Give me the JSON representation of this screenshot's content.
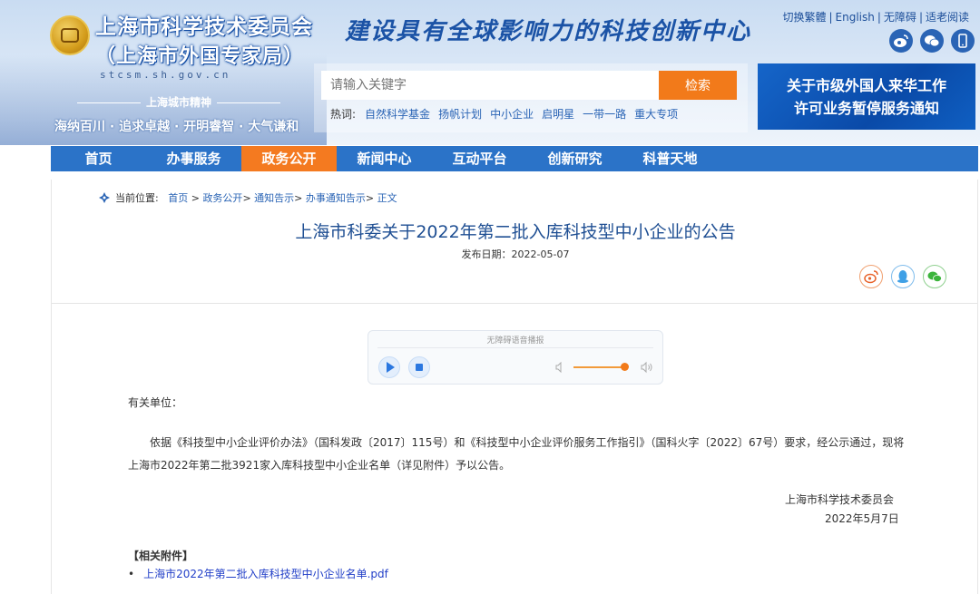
{
  "header": {
    "org_name": "上海市科学技术委员会",
    "org_subname": "（上海市外国专家局）",
    "domain": "stcsm.sh.gov.cn",
    "city_spirit_title": "上海城市精神",
    "city_spirit_text": "海纳百川 · 追求卓越 · 开明睿智 · 大气谦和",
    "slogan": "建设具有全球影响力的科技创新中心",
    "top_links": [
      "切换繁體",
      "English",
      "无障碍",
      "适老阅读"
    ],
    "top_icons": [
      "weibo-icon",
      "wechat-icon",
      "mobile-icon"
    ]
  },
  "search": {
    "placeholder": "请输入关键字",
    "button_label": "检索",
    "hot_label": "热词:",
    "hot_words": [
      "自然科学基金",
      "扬帆计划",
      "中小企业",
      "启明星",
      "一带一路",
      "重大专项"
    ]
  },
  "banner": {
    "line1": "关于市级外国人来华工作",
    "line2": "许可业务暂停服务通知"
  },
  "nav": {
    "items": [
      "首页",
      "办事服务",
      "政务公开",
      "新闻中心",
      "互动平台",
      "创新研究",
      "科普天地"
    ],
    "active": "政务公开"
  },
  "breadcrumb": {
    "label": "当前位置:",
    "items": [
      "首页",
      "政务公开",
      "通知告示",
      "办事通知告示",
      "正文"
    ],
    "separator": ">"
  },
  "article": {
    "title": "上海市科委关于2022年第二批入库科技型中小企业的公告",
    "publish_date": "发布日期：2022-05-07",
    "share_icons": [
      "weibo-share-icon",
      "qq-share-icon",
      "wechat-share-icon"
    ],
    "greeting": "有关单位：",
    "body": "依据《科技型中小企业评价办法》（国科发政〔2017〕115号）和《科技型中小企业评价服务工作指引》（国科火字〔2022〕67号）要求，经公示通过，现将上海市2022年第二批3921家入库科技型中小企业名单（详见附件）予以公告。",
    "signature_org": "上海市科学技术委员会",
    "signature_date": "2022年5月7日",
    "attachments_title": "【相关附件】",
    "attachment_name": "上海市2022年第二批入库科技型中小企业名单.pdf"
  },
  "audio_player": {
    "title": "无障碍语音播报",
    "volume": 0.85
  },
  "colors": {
    "nav_bg": "#2b73c8",
    "nav_active": "#f47a20",
    "search_button": "#f27a1a",
    "title_color": "#1f4f93",
    "link_color": "#2340c8"
  }
}
